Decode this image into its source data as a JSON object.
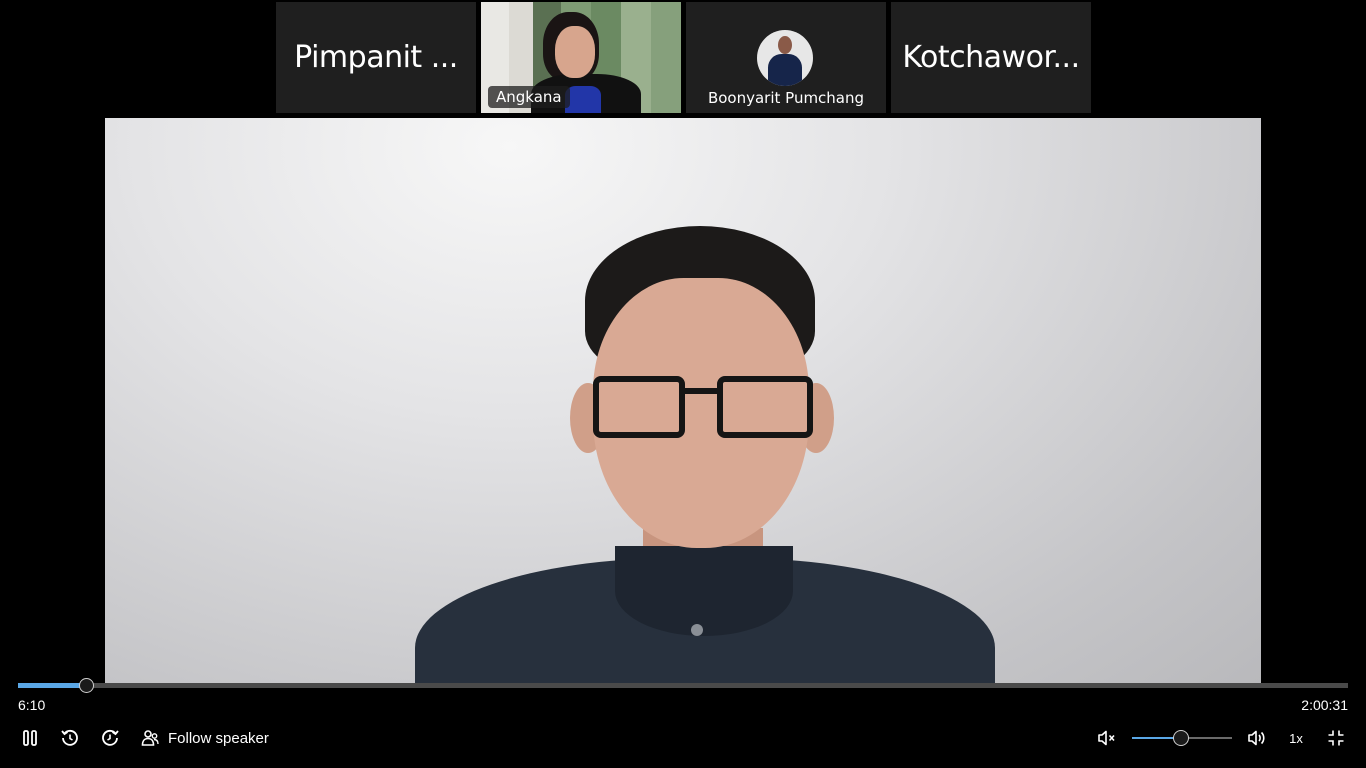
{
  "participants": [
    {
      "name": "Pimpanit ...",
      "type": "name-only"
    },
    {
      "name": "Angkana",
      "type": "video"
    },
    {
      "name": "Boonyarit Pumchang",
      "type": "avatar"
    },
    {
      "name": "Kotchawor...",
      "type": "name-only"
    }
  ],
  "player": {
    "current_time": "6:10",
    "duration": "2:00:31",
    "progress_fraction": 0.0512,
    "volume_fraction": 0.49,
    "speed": "1x",
    "follow_speaker_label": "Follow speaker"
  },
  "colors": {
    "accent": "#5aa7e6",
    "background": "#000000",
    "tile": "#1f1f1f"
  },
  "icons": [
    "pause-icon",
    "rewind-icon",
    "forward-icon",
    "follow-speaker-icon",
    "mute-icon",
    "volume-icon",
    "exit-fullscreen-icon"
  ]
}
